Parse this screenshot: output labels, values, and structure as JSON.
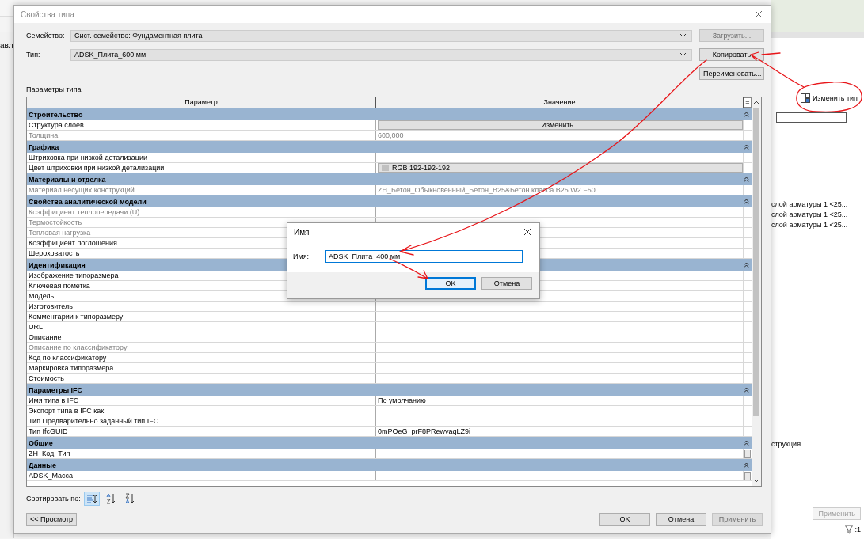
{
  "background_app": {
    "left_text": "авл",
    "panel": {
      "change_type_button": "Изменить тип",
      "rows": [
        "слой арматуры 1 <25...",
        "слой арматуры 1 <25...",
        "слой арматуры 1 <25..."
      ],
      "row_4": "струкция",
      "apply_button": "Применить"
    },
    "status_bar": {
      "filter_count": ":1"
    }
  },
  "dialog": {
    "title": "Свойства типа",
    "family": {
      "label": "Семейство:",
      "value": "Сист. семейство: Фундаментная плита"
    },
    "type": {
      "label": "Тип:",
      "value": "ADSK_Плита_600 мм"
    },
    "load_button": {
      "label": "Загрузить...",
      "disabled": true
    },
    "copy_button": {
      "label": "Копировать",
      "disabled": false
    },
    "rename_button": {
      "label": "Переименовать...",
      "disabled": false
    },
    "section_label": "Параметры типа",
    "table": {
      "columns": [
        "Параметр",
        "Значение",
        "="
      ],
      "groups": [
        {
          "title": "Строительство",
          "rows": [
            {
              "name": "Структура слоев",
              "kind": "button",
              "value": "Изменить...",
              "disabled": false,
              "linked": false
            },
            {
              "name": "Толщина",
              "kind": "text",
              "value": "600,000",
              "disabled": true,
              "linked": false
            }
          ]
        },
        {
          "title": "Графика",
          "rows": [
            {
              "name": "Штриховка при низкой детализации",
              "kind": "text",
              "disabled": false,
              "linked": false
            },
            {
              "name": "Цвет штриховки при низкой детализации",
              "kind": "color",
              "value": "RGB 192-192-192",
              "disabled": false,
              "linked": false
            }
          ]
        },
        {
          "title": "Материалы и отделка",
          "rows": [
            {
              "name": "Материал несущих конструкций",
              "kind": "text",
              "value": "ZH_Бетон_Обыкновенный_Бетон_B25&Бетон класса B25 W2 F50",
              "disabled": true,
              "linked": false
            }
          ]
        },
        {
          "title": "Свойства аналитической модели",
          "rows": [
            {
              "name": "Коэффициент теплопередачи (U)",
              "kind": "text",
              "disabled": true,
              "linked": false
            },
            {
              "name": "Термостойкость",
              "kind": "text",
              "disabled": true,
              "linked": false
            },
            {
              "name": "Тепловая нагрузка",
              "kind": "text",
              "disabled": true,
              "linked": false
            },
            {
              "name": "Коэффициент поглощения",
              "kind": "text",
              "disabled": false,
              "linked": false
            },
            {
              "name": "Шероховатость",
              "kind": "text",
              "disabled": false,
              "linked": false
            }
          ]
        },
        {
          "title": "Идентификация",
          "rows": [
            {
              "name": "Изображение типоразмера",
              "kind": "text",
              "disabled": false,
              "linked": false
            },
            {
              "name": "Ключевая пометка",
              "kind": "text",
              "disabled": false,
              "linked": false
            },
            {
              "name": "Модель",
              "kind": "text",
              "disabled": false,
              "linked": false
            },
            {
              "name": "Изготовитель",
              "kind": "text",
              "disabled": false,
              "linked": false
            },
            {
              "name": "Комментарии к типоразмеру",
              "kind": "text",
              "disabled": false,
              "linked": false
            },
            {
              "name": "URL",
              "kind": "text",
              "disabled": false,
              "linked": false
            },
            {
              "name": "Описание",
              "kind": "text",
              "disabled": false,
              "linked": false
            },
            {
              "name": "Описание по классификатору",
              "kind": "text",
              "disabled": true,
              "linked": false
            },
            {
              "name": "Код по классификатору",
              "kind": "text",
              "disabled": false,
              "linked": false
            },
            {
              "name": "Маркировка типоразмера",
              "kind": "text",
              "disabled": false,
              "linked": false
            },
            {
              "name": "Стоимость",
              "kind": "text",
              "disabled": false,
              "linked": false
            }
          ]
        },
        {
          "title": "Параметры IFC",
          "rows": [
            {
              "name": "Имя типа в IFC",
              "kind": "text",
              "value": "По умолчанию",
              "disabled": false,
              "linked": false
            },
            {
              "name": "Экспорт типа в IFC как",
              "kind": "text",
              "disabled": false,
              "linked": false
            },
            {
              "name": "Тип Предварительно заданный тип IFC",
              "kind": "text",
              "disabled": false,
              "linked": false
            },
            {
              "name": "Тип IfcGUID",
              "kind": "text",
              "value": "0mPOeG_prF8PRewvaqLZ9i",
              "disabled": false,
              "linked": false
            }
          ]
        },
        {
          "title": "Общие",
          "rows": [
            {
              "name": "ZH_Код_Тип",
              "kind": "text",
              "disabled": false,
              "linked": true
            }
          ]
        },
        {
          "title": "Данные",
          "rows": [
            {
              "name": "ADSK_Масса",
              "kind": "text",
              "disabled": false,
              "linked": true
            }
          ]
        }
      ]
    },
    "sort_label": "Сортировать по:",
    "sort_options": [
      {
        "kind": "group",
        "selected": true
      },
      {
        "kind": "asc",
        "selected": false
      },
      {
        "kind": "desc",
        "selected": false
      }
    ],
    "preview_button": "<< Просмотр",
    "buttons": [
      {
        "label": "OK",
        "disabled": false
      },
      {
        "label": "Отмена",
        "disabled": false
      },
      {
        "label": "Применить",
        "disabled": true
      }
    ]
  },
  "name_dialog": {
    "title": "Имя",
    "label": "Имя:",
    "value": "ADSK_Плита_400 мм",
    "buttons": [
      {
        "label": "OK",
        "focused": true
      },
      {
        "label": "Отмена",
        "focused": false
      }
    ]
  }
}
